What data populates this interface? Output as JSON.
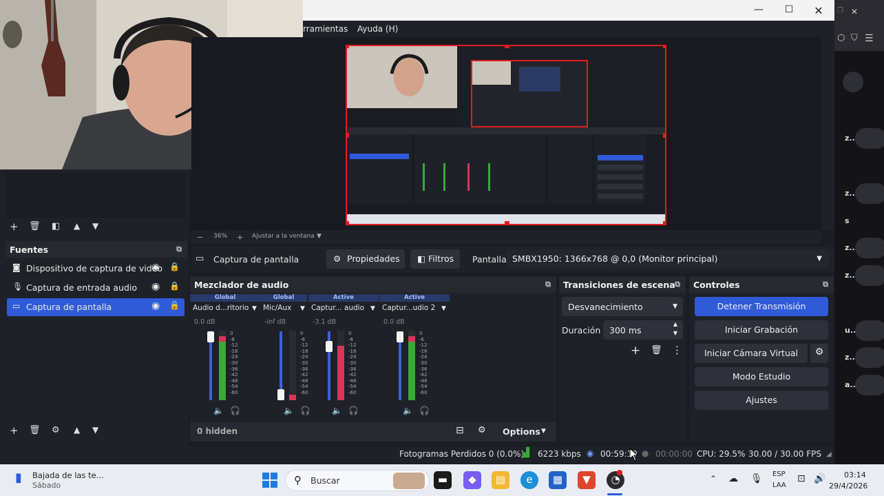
{
  "menubar": {
    "tools": "rramientas",
    "help": "Ayuda (H)"
  },
  "zoom": {
    "percent": "36%",
    "fit": "Ajustar a la ventana"
  },
  "scenes_panel": {},
  "sources": {
    "title": "Fuentes",
    "items": [
      {
        "label": "Dispositivo de captura de video",
        "icon": "camera-icon"
      },
      {
        "label": "Captura de entrada audio",
        "icon": "microphone-icon"
      },
      {
        "label": "Captura de pantalla",
        "icon": "monitor-icon",
        "selected": true
      }
    ]
  },
  "properties_bar": {
    "source_name": "Captura de pantalla",
    "properties_label": "Propiedades",
    "filters_label": "Filtros",
    "display_label": "Pantalla",
    "display_value": "SMBX1950: 1366x768 @ 0,0 (Monitor principal)"
  },
  "mixer": {
    "title": "Mezclador de audio",
    "channels": [
      {
        "tag": "Global",
        "name": "Audio d...ritorio",
        "db": "0.0 dB",
        "level": 0.92
      },
      {
        "tag": "Global",
        "name": "Mic/Aux",
        "db": "-inf dB",
        "level": 0.08
      },
      {
        "tag": "Active",
        "name": "Captur... audio",
        "db": "-3.1 dB",
        "level": 0.78
      },
      {
        "tag": "Active",
        "name": "Captur...udio 2",
        "db": "0.0 dB",
        "level": 0.92
      }
    ],
    "scale": [
      "0",
      "-6",
      "-12",
      "-18",
      "-24",
      "-30",
      "-36",
      "-42",
      "-48",
      "-54",
      "-60"
    ],
    "hidden_label": "0 hidden",
    "options_label": "Options"
  },
  "transitions": {
    "title": "Transiciones de escena",
    "selected": "Desvanecimiento",
    "duration_label": "Duración",
    "duration_value": "300 ms"
  },
  "controls": {
    "title": "Controles",
    "stop_stream": "Detener Transmisión",
    "start_recording": "Iniciar Grabación",
    "start_virtual_cam": "Iniciar Cámara Virtual",
    "studio_mode": "Modo Estudio",
    "settings": "Ajustes"
  },
  "status": {
    "dropped_frames": "Fotogramas Perdidos 0 (0.0%)",
    "bitrate": "6223 kbps",
    "stream_time": "00:59:19",
    "rec_time": "00:00:00",
    "cpu": "CPU: 29.5%",
    "fps": "30.00 / 30.00 FPS"
  },
  "taskbar": {
    "notification_title": "Bajada de las te...",
    "notification_sub": "Sábado",
    "search_placeholder": "Buscar",
    "lang_top": "ESP",
    "lang_bottom": "LAA",
    "time": "03:14",
    "date": "29/4/2026"
  },
  "right_app": {
    "items": [
      "z..",
      "z..",
      "z..",
      "u..",
      "z..",
      "s",
      "z..",
      "a.."
    ]
  },
  "colors": {
    "accent": "#2f5bd8",
    "record_red": "#e01e1e",
    "meter_green": "#3aa83a",
    "meter_red": "#d9345a"
  }
}
